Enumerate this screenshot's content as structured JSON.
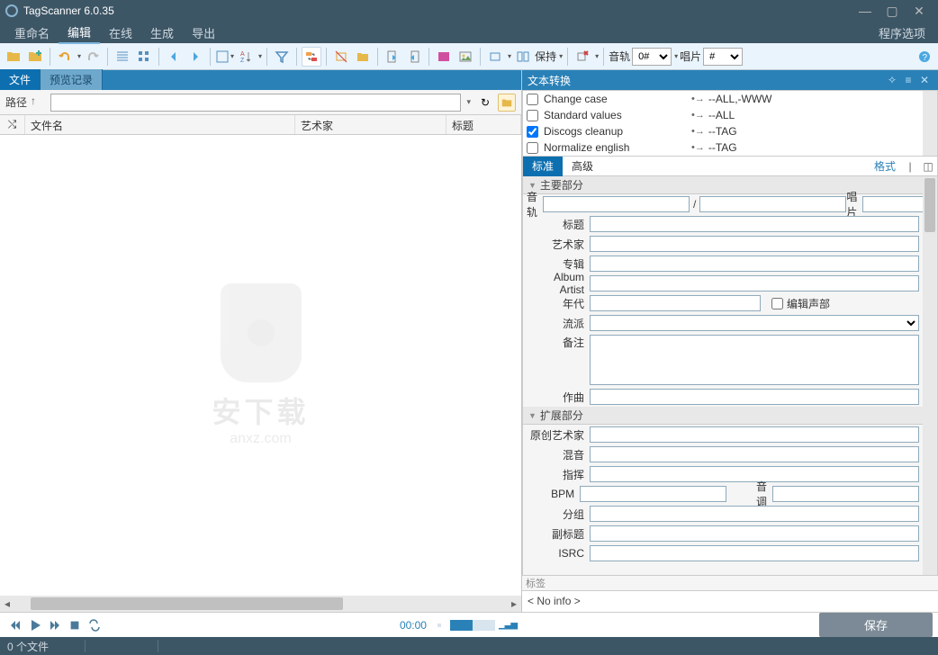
{
  "app": {
    "title": "TagScanner 6.0.35"
  },
  "menu": {
    "items": [
      "重命名",
      "编辑",
      "在线",
      "生成",
      "导出"
    ],
    "active": "编辑",
    "options": "程序选项"
  },
  "toolbar": {
    "keep_label": "保持",
    "track_label": "音轨",
    "track_value": "0#",
    "album_label": "唱片",
    "album_value": "#"
  },
  "left": {
    "tab_file": "文件",
    "tab_preview": "预览记录",
    "path_label": "路径",
    "col_shuffle": "⤭",
    "col_filename": "文件名",
    "col_artist": "艺术家",
    "col_title": "标题"
  },
  "watermark": {
    "main": "安下载",
    "sub": "anxz.com"
  },
  "transforms": {
    "title": "文本转换",
    "rows": [
      {
        "name": "Change case",
        "target": "--ALL,-WWW",
        "checked": false
      },
      {
        "name": "Standard values",
        "target": "--ALL",
        "checked": false
      },
      {
        "name": "Discogs cleanup",
        "target": "--TAG",
        "checked": true
      },
      {
        "name": "Normalize english",
        "target": "--TAG",
        "checked": false
      }
    ]
  },
  "editor": {
    "tab_standard": "标准",
    "tab_advanced": "高级",
    "format_link": "格式",
    "sec_main": "主要部分",
    "sec_ext": "扩展部分",
    "labels": {
      "track": "音轨",
      "album_no": "唱片",
      "title": "标题",
      "artist": "艺术家",
      "album": "专辑",
      "album_artist": "Album Artist",
      "year": "年代",
      "edit_voice": "编辑声部",
      "genre": "流派",
      "comment": "备注",
      "composer": "作曲",
      "orig_artist": "原创艺术家",
      "remix": "混音",
      "conductor": "指挥",
      "bpm": "BPM",
      "key": "音调",
      "group": "分组",
      "subtitle": "副标题",
      "isrc": "ISRC"
    }
  },
  "taglabel": "标签",
  "noinfo": "< No info >",
  "player": {
    "time": "00:00",
    "save": "保存"
  },
  "status": {
    "files": "0 个文件"
  }
}
